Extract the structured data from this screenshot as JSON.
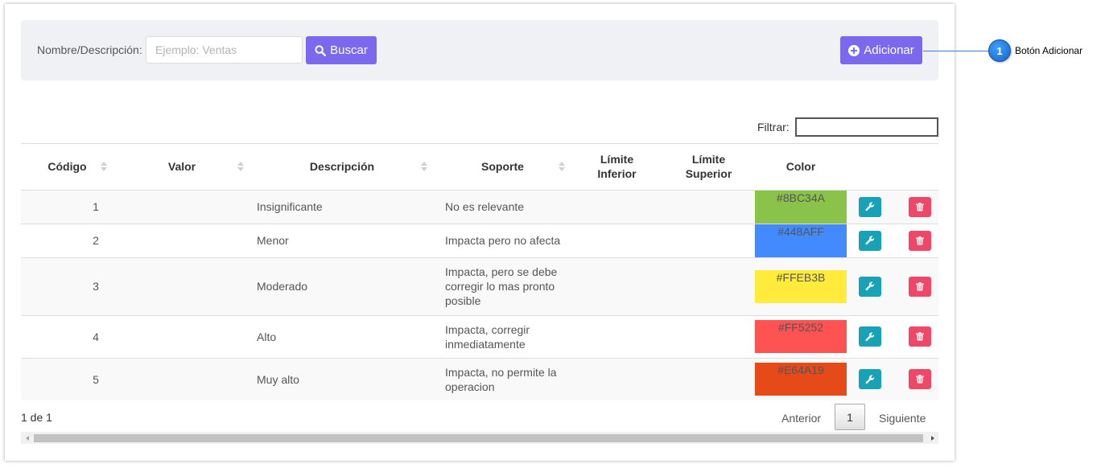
{
  "search": {
    "label": "Nombre/Descripción:",
    "placeholder": "Ejemplo: Ventas",
    "value": "",
    "button_label": "Buscar",
    "search_icon": "search-icon"
  },
  "add_button": {
    "label": "Adicionar",
    "icon": "plus-circle-icon"
  },
  "filter": {
    "label": "Filtrar:",
    "value": ""
  },
  "table": {
    "headers": {
      "codigo": "Código",
      "valor": "Valor",
      "descripcion": "Descripción",
      "soporte": "Soporte",
      "limite_inferior": "Límite Inferior",
      "limite_superior": "Límite Superior",
      "color": "Color"
    },
    "rows": [
      {
        "codigo": "1",
        "valor": "",
        "descripcion": "Insignificante",
        "soporte": "No es relevante",
        "limite_inferior": "",
        "limite_superior": "",
        "color": "#8BC34A"
      },
      {
        "codigo": "2",
        "valor": "",
        "descripcion": "Menor",
        "soporte": "Impacta pero no afecta",
        "limite_inferior": "",
        "limite_superior": "",
        "color": "#448AFF"
      },
      {
        "codigo": "3",
        "valor": "",
        "descripcion": "Moderado",
        "soporte": "Impacta, pero se debe corregir lo mas pronto posible",
        "limite_inferior": "",
        "limite_superior": "",
        "color": "#FFEB3B"
      },
      {
        "codigo": "4",
        "valor": "",
        "descripcion": "Alto",
        "soporte": "Impacta, corregir inmediatamente",
        "limite_inferior": "",
        "limite_superior": "",
        "color": "#FF5252"
      },
      {
        "codigo": "5",
        "valor": "",
        "descripcion": "Muy alto",
        "soporte": "Impacta, no permite la operacion",
        "limite_inferior": "",
        "limite_superior": "",
        "color": "#E64A19"
      }
    ],
    "row_actions": {
      "edit_icon": "wrench-icon",
      "delete_icon": "trash-icon"
    }
  },
  "pagination": {
    "info": "1 de 1",
    "prev_label": "Anterior",
    "current_page": "1",
    "next_label": "Siguiente"
  },
  "callout": {
    "number": "1",
    "text": "Botón Adicionar"
  },
  "colors": {
    "accent": "#7b68ee",
    "edit_button": "#17a2b8",
    "delete_button": "#ef4768",
    "callout": "#1e88e5"
  }
}
